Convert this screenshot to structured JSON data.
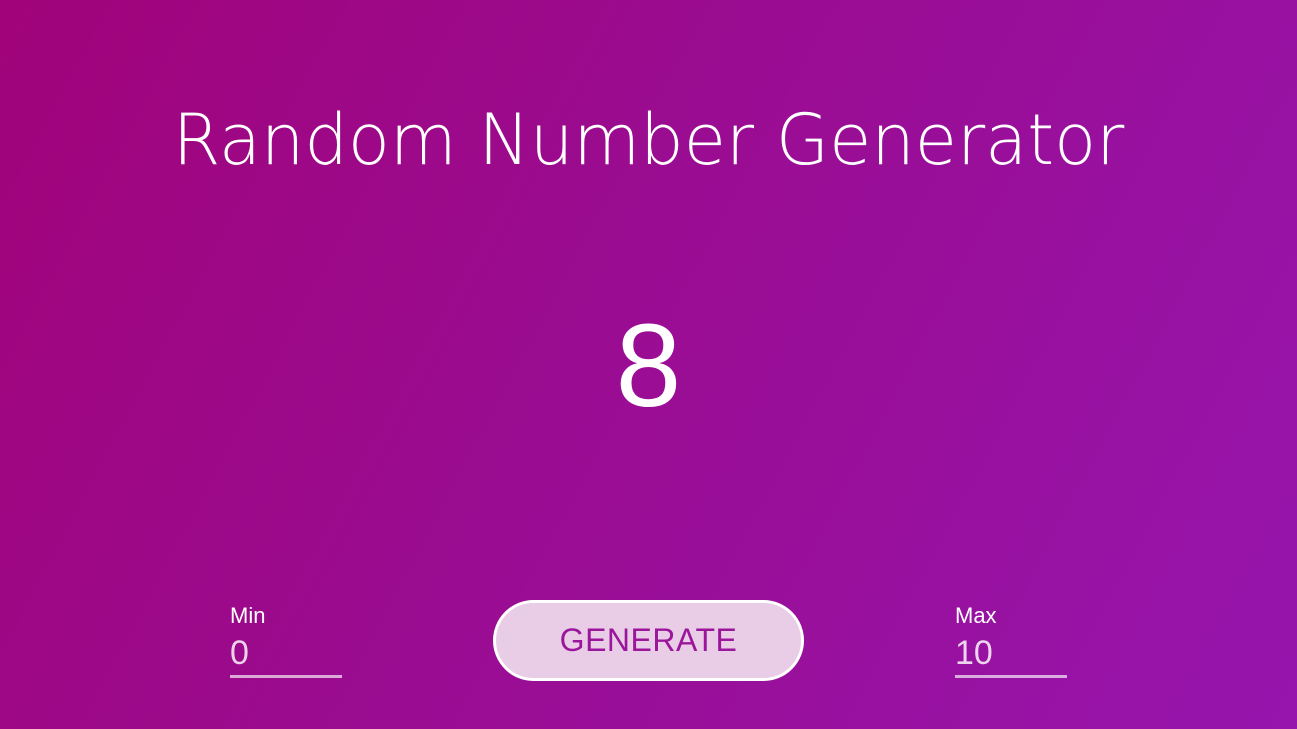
{
  "app": {
    "title": "Random Number Generator"
  },
  "result": {
    "value": "8"
  },
  "min": {
    "label": "Min",
    "value": "0"
  },
  "max": {
    "label": "Max",
    "value": "10"
  },
  "generate": {
    "label": "GENERATE"
  },
  "colors": {
    "background_start": "#a1037a",
    "background_end": "#9715ad",
    "button_background": "#e9cde7",
    "button_text": "#9a179b",
    "text": "#ffffff"
  }
}
